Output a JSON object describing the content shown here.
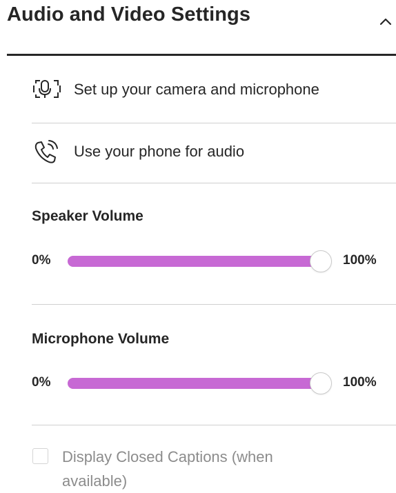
{
  "header": {
    "title": "Audio and Video Settings",
    "collapse_icon": "chevron-up-icon"
  },
  "actions": [
    {
      "label": "Set up your camera and microphone",
      "icon": "camera-microphone-icon"
    },
    {
      "label": "Use your phone for audio",
      "icon": "phone-audio-icon"
    }
  ],
  "speaker_volume": {
    "title": "Speaker Volume",
    "min_label": "0%",
    "max_label": "100%",
    "value_percent": 100
  },
  "microphone_volume": {
    "title": "Microphone Volume",
    "min_label": "0%",
    "max_label": "100%",
    "value_percent": 100
  },
  "captions": {
    "label": "Display Closed Captions (when available)",
    "checked": false
  },
  "colors": {
    "slider_fill": "#c769d4",
    "text": "#262626",
    "muted_text": "#8c8c8c",
    "divider": "#cfcfcf"
  }
}
